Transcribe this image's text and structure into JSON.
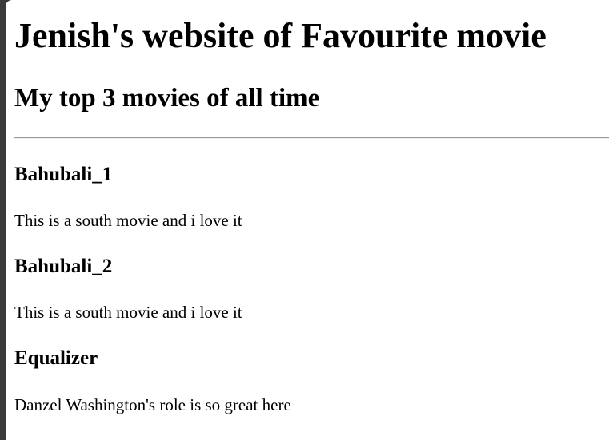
{
  "page": {
    "title": "Jenish's website of Favourite movie",
    "subtitle": "My top 3 movies of all time"
  },
  "movies": [
    {
      "title": "Bahubali_1",
      "description": "This is a south movie and i love it"
    },
    {
      "title": "Bahubali_2",
      "description": "This is a south movie and i love it"
    },
    {
      "title": "Equalizer",
      "description": "Danzel Washington's role is so great here"
    }
  ],
  "colors": {
    "background": "#ffffff",
    "text": "#000000",
    "divider": "#9a9a9a",
    "window_frame": "#3a3a3a"
  }
}
